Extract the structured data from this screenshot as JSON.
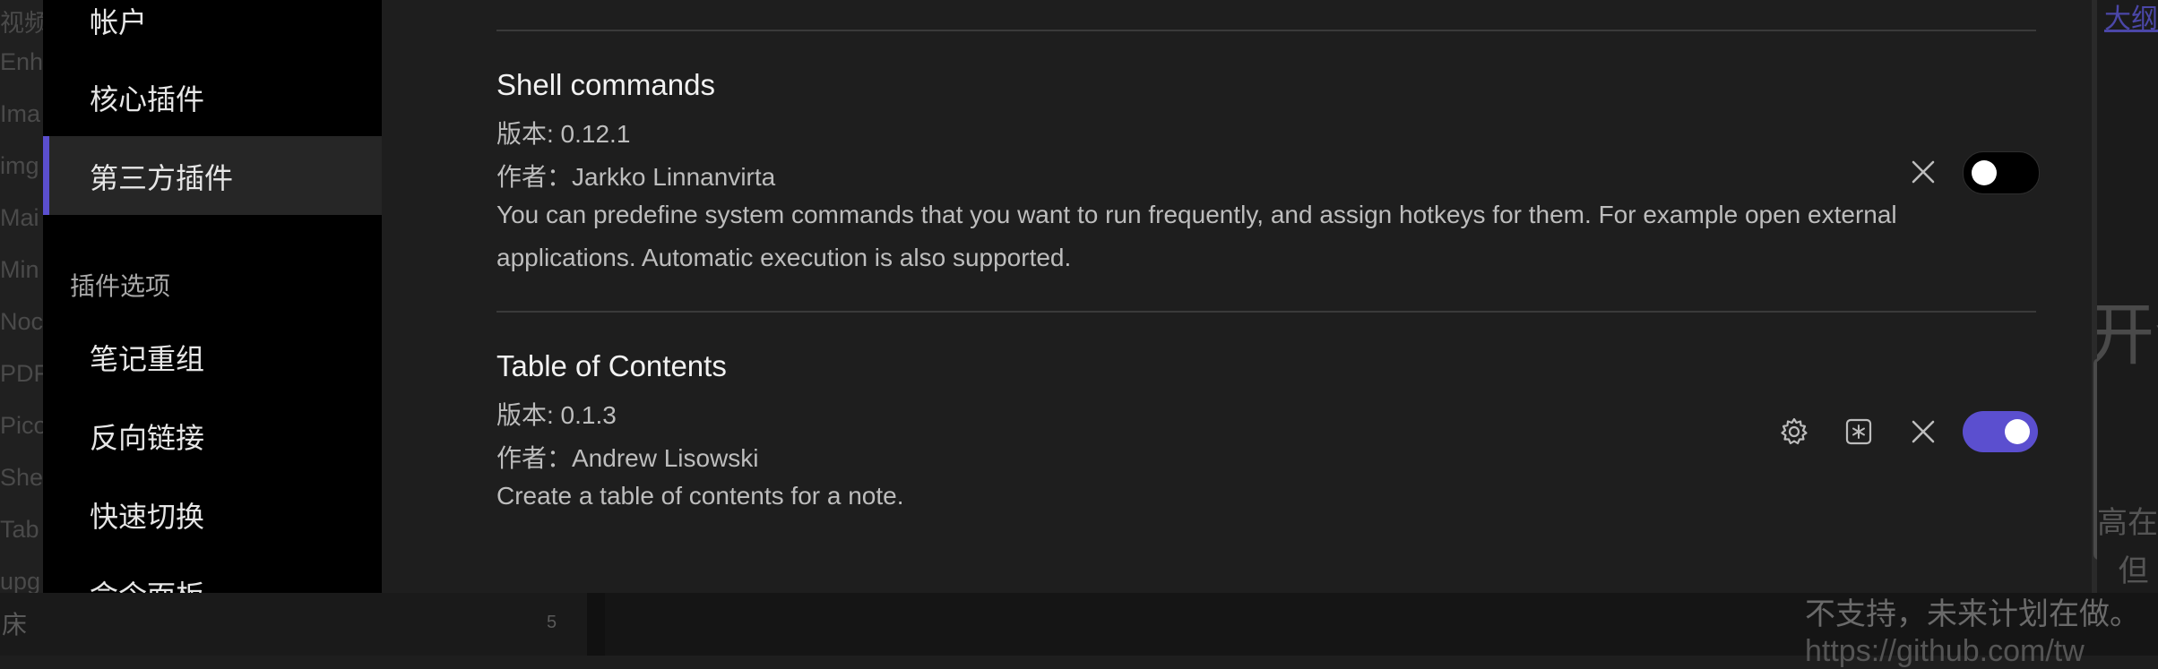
{
  "background": {
    "left_list": [
      "视频",
      "Enh",
      "Ima",
      "img",
      "Mai",
      "Min",
      "Noc",
      "PDF",
      "Pico",
      "She",
      "Tab",
      "upg"
    ],
    "bottom_left_text": "床",
    "bottom_left_count": "5",
    "right_link": "大纲",
    "right_big": "开介",
    "right_lines": [
      "高在",
      "。 但",
      "不支持，未来计划在做。",
      "https://github.com/tw"
    ]
  },
  "sidebar": {
    "items": [
      {
        "label": "帐户"
      },
      {
        "label": "核心插件"
      },
      {
        "label": "第三方插件",
        "active": true
      }
    ],
    "plugin_options_heading": "插件选项",
    "option_items": [
      {
        "label": "笔记重组"
      },
      {
        "label": "反向链接"
      },
      {
        "label": "快速切换"
      },
      {
        "label": "命令面板"
      }
    ]
  },
  "plugins": [
    {
      "name": "Shell commands",
      "version_label": "版本: 0.12.1",
      "author_label": "作者：Jarkko Linnanvirta",
      "description": "You can predefine system commands that you want to run frequently, and assign hotkeys for them. For example open external applications. Automatic execution is also supported.",
      "enabled": false
    },
    {
      "name": "Table of Contents",
      "version_label": "版本: 0.1.3",
      "author_label": "作者：Andrew Lisowski",
      "description": "Create a table of contents for a note.",
      "enabled": true
    }
  ],
  "icons": {
    "settings": "gear-icon",
    "hotkeys": "hotkey-icon",
    "uninstall": "close-icon"
  },
  "colors": {
    "accent": "#5b4fcf",
    "toggle_off": "#000000",
    "sidebar_bg": "#000000",
    "content_bg": "#1e1e1e"
  }
}
